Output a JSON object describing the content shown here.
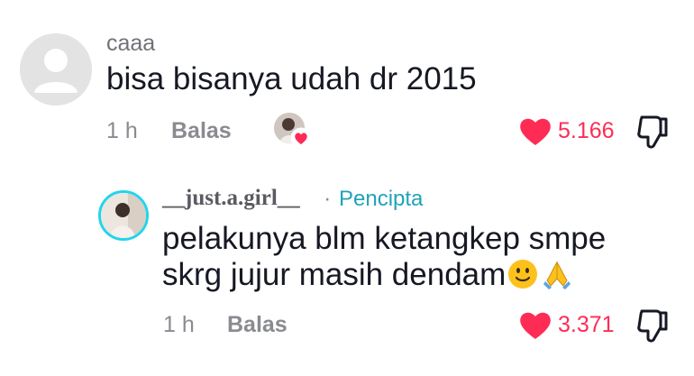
{
  "comment": {
    "username": "caaa",
    "text": "bisa bisanya udah dr 2015",
    "time": "1 h",
    "reply_label": "Balas",
    "like_count": "5.166"
  },
  "reply": {
    "username": "__just.a.girl__",
    "separator": "·",
    "creator_badge": "Pencipta",
    "text_line1": "pelakunya blm ketangkep smpe",
    "text_line2": "skrg jujur masih dendam",
    "time": "1 h",
    "reply_label": "Balas",
    "like_count": "3.371"
  },
  "colors": {
    "like_red": "#fe2c55",
    "creator_teal": "#21a3b8",
    "meta_gray": "#8a8b91"
  },
  "icons": {
    "like": "heart-icon",
    "dislike": "thumbs-down-icon",
    "creator_liked": "creator-liked-heart-icon",
    "emoji1": "slightly-smiling-face-emoji",
    "emoji2": "folded-hands-emoji"
  }
}
